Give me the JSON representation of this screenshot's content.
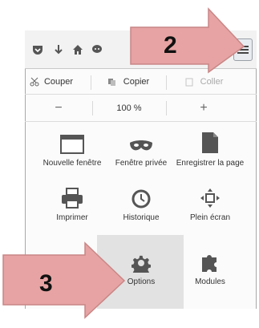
{
  "annotations": {
    "step2": "2",
    "step3": "3"
  },
  "edit": {
    "cut": "Couper",
    "copy": "Copier",
    "paste": "Coller"
  },
  "zoom": {
    "minus": "−",
    "level": "100 %",
    "plus": "+"
  },
  "items": [
    {
      "label": "Nouvelle fenêtre",
      "icon": "new-window-icon"
    },
    {
      "label": "Fenêtre privée",
      "icon": "private-mask-icon"
    },
    {
      "label": "Enregistrer la page",
      "icon": "save-page-icon"
    },
    {
      "label": "Imprimer",
      "icon": "printer-icon"
    },
    {
      "label": "Historique",
      "icon": "history-clock-icon"
    },
    {
      "label": "Plein écran",
      "icon": "fullscreen-icon"
    },
    {
      "label": "Options",
      "icon": "gear-icon"
    },
    {
      "label": "Modules",
      "icon": "puzzle-icon"
    }
  ],
  "colors": {
    "arrow_fill": "#e7a3a3",
    "arrow_stroke": "#c98686",
    "highlight": "#e2e2e2"
  }
}
